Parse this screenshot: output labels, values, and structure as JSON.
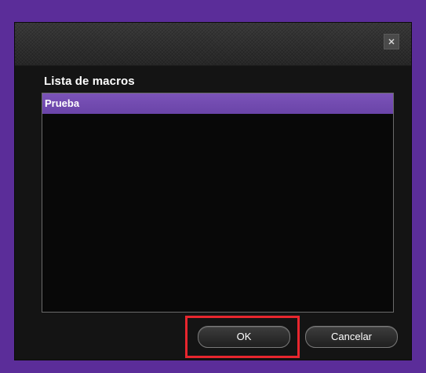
{
  "dialog": {
    "close_label": "×",
    "list_heading": "Lista de macros",
    "items": [
      {
        "label": "Prueba",
        "selected": true
      }
    ],
    "ok_label": "OK",
    "cancel_label": "Cancelar"
  },
  "colors": {
    "background": "#5b2d99",
    "dialog_bg": "#141414",
    "selection": "#7049ae",
    "highlight": "#e8262e"
  },
  "icons": {
    "close": "close-icon"
  }
}
